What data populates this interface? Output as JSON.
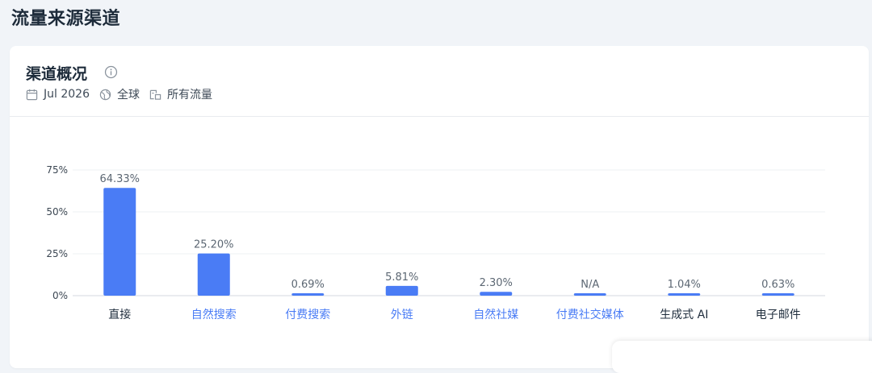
{
  "page": {
    "title": "流量来源渠道"
  },
  "card": {
    "title": "渠道概况",
    "date": "Jul 2026",
    "region": "全球",
    "traffic": "所有流量"
  },
  "icons": {
    "info": "info-icon",
    "date": "calendar-icon",
    "region": "globe-icon",
    "traffic": "traffic-icon"
  },
  "colors": {
    "bar": "#4a7cf5",
    "link": "#4a7cf5"
  },
  "chart_data": {
    "type": "bar",
    "categories": [
      "直接",
      "自然搜索",
      "付费搜索",
      "外链",
      "自然社媒",
      "付费社交媒体",
      "生成式 AI",
      "电子邮件"
    ],
    "values": [
      64.33,
      25.2,
      0.69,
      5.81,
      2.3,
      null,
      1.04,
      0.63
    ],
    "data_labels": [
      "64.33%",
      "25.20%",
      "0.69%",
      "5.81%",
      "2.30%",
      "N/A",
      "1.04%",
      "0.63%"
    ],
    "linked": [
      false,
      true,
      true,
      true,
      true,
      true,
      false,
      false
    ],
    "yticks": [
      "0%",
      "25%",
      "50%",
      "75%"
    ],
    "ylim": [
      0,
      75
    ],
    "title": "",
    "xlabel": "",
    "ylabel": "",
    "grid": true
  }
}
